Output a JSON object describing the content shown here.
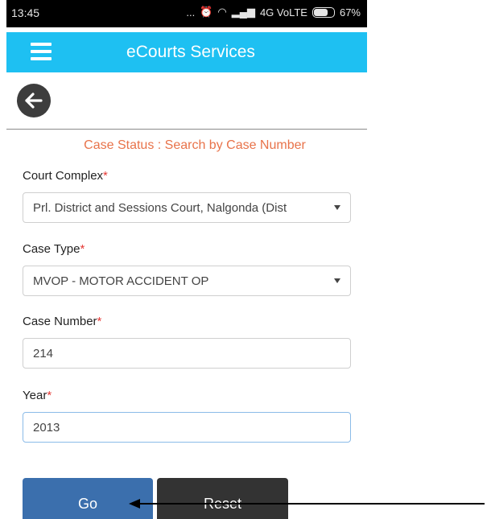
{
  "status_bar": {
    "time": "13:45",
    "more": "...",
    "network": "4G VoLTE",
    "battery": "67%",
    "battery_level": 0.67
  },
  "app_bar": {
    "title": "eCourts Services"
  },
  "form": {
    "title": "Case Status : Search by Case Number",
    "required_mark": "*",
    "court_complex": {
      "label": "Court Complex",
      "value": "Prl. District and Sessions Court, Nalgonda (Dist"
    },
    "case_type": {
      "label": "Case Type",
      "value": "MVOP - MOTOR ACCIDENT OP"
    },
    "case_number": {
      "label": "Case Number",
      "value": "214"
    },
    "year": {
      "label": "Year",
      "value": "2013"
    }
  },
  "buttons": {
    "go": "Go",
    "reset": "Reset"
  },
  "colors": {
    "app_bar": "#1ec0f2",
    "title_accent": "#e8734a",
    "required": "#e53935",
    "go_button": "#3b6fad",
    "reset_button": "#333333"
  },
  "icons": {
    "menu": "menu-icon",
    "back": "back-arrow-icon",
    "annotation": "pointer-arrow-icon"
  }
}
